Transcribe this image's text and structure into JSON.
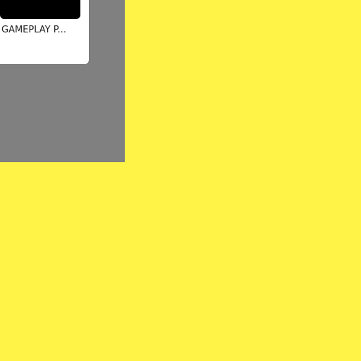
{
  "colors": {
    "background": "#FFF347",
    "panel": "#808080",
    "card": "#FFFFFF",
    "thumbnail": "#000000"
  },
  "card": {
    "title": "GAMEPLAY P..."
  }
}
